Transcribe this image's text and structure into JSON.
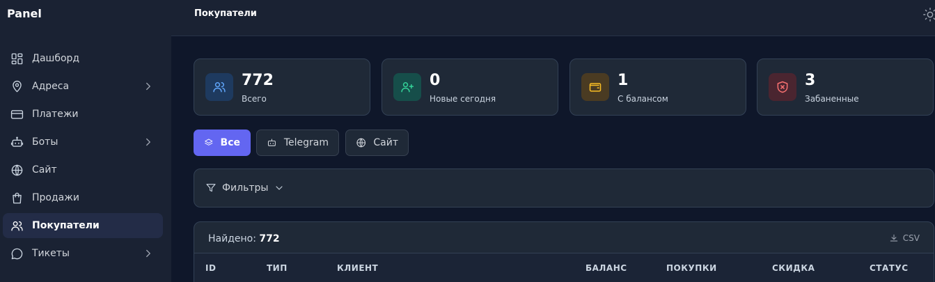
{
  "brand": "Panel",
  "header": {
    "title": "Покупатели"
  },
  "sidebar": {
    "items": [
      {
        "label": "Дашборд",
        "icon": "dashboard-icon"
      },
      {
        "label": "Адреса",
        "icon": "map-pin-icon",
        "expandable": true
      },
      {
        "label": "Платежи",
        "icon": "credit-card-icon"
      },
      {
        "label": "Боты",
        "icon": "bot-icon",
        "expandable": true
      },
      {
        "label": "Сайт",
        "icon": "globe-icon"
      },
      {
        "label": "Продажи",
        "icon": "shopping-bag-icon"
      },
      {
        "label": "Покупатели",
        "icon": "users-icon",
        "active": true
      },
      {
        "label": "Тикеты",
        "icon": "chat-bubble-icon",
        "expandable": true
      }
    ]
  },
  "stats": [
    {
      "value": "772",
      "label": "Всего",
      "icon": "users-icon",
      "color": "#3b82f6"
    },
    {
      "value": "0",
      "label": "Новые сегодня",
      "icon": "user-plus-icon",
      "color": "#10b981"
    },
    {
      "value": "1",
      "label": "С балансом",
      "icon": "wallet-icon",
      "color": "#f59e0b"
    },
    {
      "value": "3",
      "label": "Забаненные",
      "icon": "shield-x-icon",
      "color": "#ef4444"
    }
  ],
  "tabs": [
    {
      "label": "Все",
      "icon": "layers-icon",
      "active": true
    },
    {
      "label": "Telegram",
      "icon": "bot-icon"
    },
    {
      "label": "Сайт",
      "icon": "globe-icon"
    }
  ],
  "filters": {
    "label": "Фильтры"
  },
  "table": {
    "found_label": "Найдено:",
    "found_count": "772",
    "export_label": "CSV",
    "columns": [
      "ID",
      "ТИП",
      "КЛИЕНТ",
      "БАЛАНС",
      "ПОКУПКИ",
      "СКИДКА",
      "СТАТУС"
    ]
  },
  "colors": {
    "accent": "#6366f1",
    "sidebar_bg": "#1a2233",
    "main_bg": "#0f172a"
  }
}
